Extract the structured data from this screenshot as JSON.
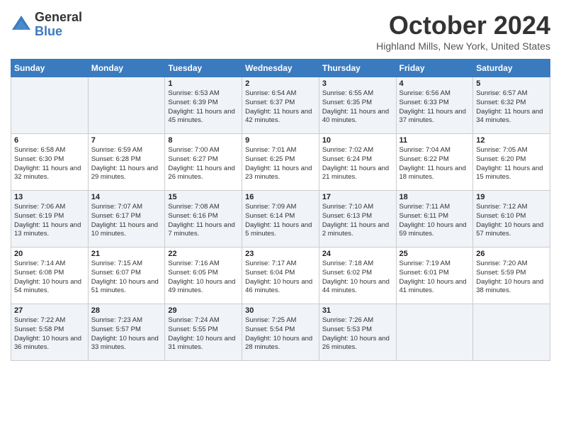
{
  "logo": {
    "general": "General",
    "blue": "Blue"
  },
  "title": "October 2024",
  "location": "Highland Mills, New York, United States",
  "weekdays": [
    "Sunday",
    "Monday",
    "Tuesday",
    "Wednesday",
    "Thursday",
    "Friday",
    "Saturday"
  ],
  "weeks": [
    [
      {
        "day": "",
        "info": ""
      },
      {
        "day": "",
        "info": ""
      },
      {
        "day": "1",
        "info": "Sunrise: 6:53 AM\nSunset: 6:39 PM\nDaylight: 11 hours and 45 minutes."
      },
      {
        "day": "2",
        "info": "Sunrise: 6:54 AM\nSunset: 6:37 PM\nDaylight: 11 hours and 42 minutes."
      },
      {
        "day": "3",
        "info": "Sunrise: 6:55 AM\nSunset: 6:35 PM\nDaylight: 11 hours and 40 minutes."
      },
      {
        "day": "4",
        "info": "Sunrise: 6:56 AM\nSunset: 6:33 PM\nDaylight: 11 hours and 37 minutes."
      },
      {
        "day": "5",
        "info": "Sunrise: 6:57 AM\nSunset: 6:32 PM\nDaylight: 11 hours and 34 minutes."
      }
    ],
    [
      {
        "day": "6",
        "info": "Sunrise: 6:58 AM\nSunset: 6:30 PM\nDaylight: 11 hours and 32 minutes."
      },
      {
        "day": "7",
        "info": "Sunrise: 6:59 AM\nSunset: 6:28 PM\nDaylight: 11 hours and 29 minutes."
      },
      {
        "day": "8",
        "info": "Sunrise: 7:00 AM\nSunset: 6:27 PM\nDaylight: 11 hours and 26 minutes."
      },
      {
        "day": "9",
        "info": "Sunrise: 7:01 AM\nSunset: 6:25 PM\nDaylight: 11 hours and 23 minutes."
      },
      {
        "day": "10",
        "info": "Sunrise: 7:02 AM\nSunset: 6:24 PM\nDaylight: 11 hours and 21 minutes."
      },
      {
        "day": "11",
        "info": "Sunrise: 7:04 AM\nSunset: 6:22 PM\nDaylight: 11 hours and 18 minutes."
      },
      {
        "day": "12",
        "info": "Sunrise: 7:05 AM\nSunset: 6:20 PM\nDaylight: 11 hours and 15 minutes."
      }
    ],
    [
      {
        "day": "13",
        "info": "Sunrise: 7:06 AM\nSunset: 6:19 PM\nDaylight: 11 hours and 13 minutes."
      },
      {
        "day": "14",
        "info": "Sunrise: 7:07 AM\nSunset: 6:17 PM\nDaylight: 11 hours and 10 minutes."
      },
      {
        "day": "15",
        "info": "Sunrise: 7:08 AM\nSunset: 6:16 PM\nDaylight: 11 hours and 7 minutes."
      },
      {
        "day": "16",
        "info": "Sunrise: 7:09 AM\nSunset: 6:14 PM\nDaylight: 11 hours and 5 minutes."
      },
      {
        "day": "17",
        "info": "Sunrise: 7:10 AM\nSunset: 6:13 PM\nDaylight: 11 hours and 2 minutes."
      },
      {
        "day": "18",
        "info": "Sunrise: 7:11 AM\nSunset: 6:11 PM\nDaylight: 10 hours and 59 minutes."
      },
      {
        "day": "19",
        "info": "Sunrise: 7:12 AM\nSunset: 6:10 PM\nDaylight: 10 hours and 57 minutes."
      }
    ],
    [
      {
        "day": "20",
        "info": "Sunrise: 7:14 AM\nSunset: 6:08 PM\nDaylight: 10 hours and 54 minutes."
      },
      {
        "day": "21",
        "info": "Sunrise: 7:15 AM\nSunset: 6:07 PM\nDaylight: 10 hours and 51 minutes."
      },
      {
        "day": "22",
        "info": "Sunrise: 7:16 AM\nSunset: 6:05 PM\nDaylight: 10 hours and 49 minutes."
      },
      {
        "day": "23",
        "info": "Sunrise: 7:17 AM\nSunset: 6:04 PM\nDaylight: 10 hours and 46 minutes."
      },
      {
        "day": "24",
        "info": "Sunrise: 7:18 AM\nSunset: 6:02 PM\nDaylight: 10 hours and 44 minutes."
      },
      {
        "day": "25",
        "info": "Sunrise: 7:19 AM\nSunset: 6:01 PM\nDaylight: 10 hours and 41 minutes."
      },
      {
        "day": "26",
        "info": "Sunrise: 7:20 AM\nSunset: 5:59 PM\nDaylight: 10 hours and 38 minutes."
      }
    ],
    [
      {
        "day": "27",
        "info": "Sunrise: 7:22 AM\nSunset: 5:58 PM\nDaylight: 10 hours and 36 minutes."
      },
      {
        "day": "28",
        "info": "Sunrise: 7:23 AM\nSunset: 5:57 PM\nDaylight: 10 hours and 33 minutes."
      },
      {
        "day": "29",
        "info": "Sunrise: 7:24 AM\nSunset: 5:55 PM\nDaylight: 10 hours and 31 minutes."
      },
      {
        "day": "30",
        "info": "Sunrise: 7:25 AM\nSunset: 5:54 PM\nDaylight: 10 hours and 28 minutes."
      },
      {
        "day": "31",
        "info": "Sunrise: 7:26 AM\nSunset: 5:53 PM\nDaylight: 10 hours and 26 minutes."
      },
      {
        "day": "",
        "info": ""
      },
      {
        "day": "",
        "info": ""
      }
    ]
  ]
}
